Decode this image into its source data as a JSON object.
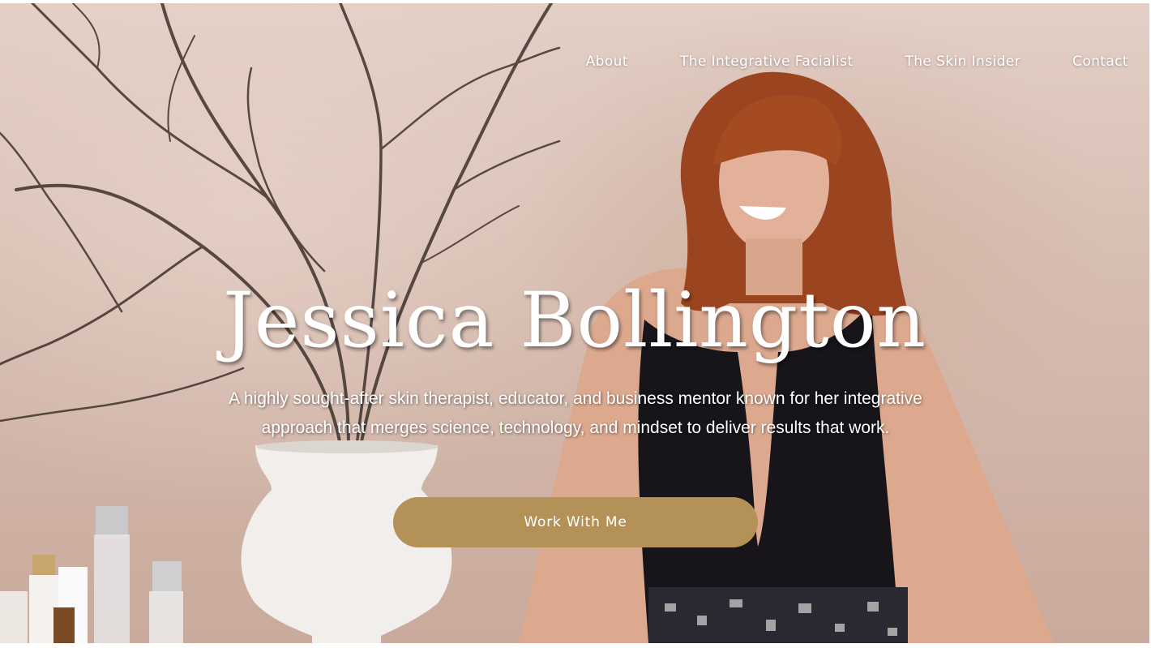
{
  "nav": {
    "items": [
      {
        "label": "About"
      },
      {
        "label": "The Integrative Facialist"
      },
      {
        "label": "The Skin Insider"
      },
      {
        "label": "Contact"
      }
    ]
  },
  "hero": {
    "title": "Jessica Bollington",
    "subtitle": "A highly sought-after skin therapist, educator, and business mentor known for her integrative approach that merges science, technology, and mindset to deliver results that work.",
    "cta_label": "Work With Me"
  },
  "colors": {
    "cta_background": "#b39157",
    "text": "#ffffff"
  }
}
